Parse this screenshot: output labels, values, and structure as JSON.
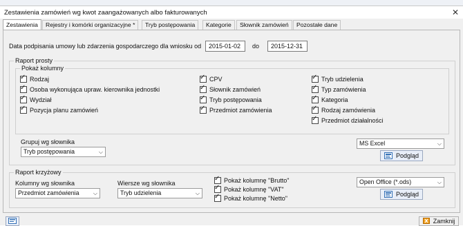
{
  "window": {
    "title": "Zestawienia zamówień wg kwot zaangażowanych albo fakturowanych",
    "close_glyph": "✕"
  },
  "tabs": [
    {
      "label": "Zestawienia"
    },
    {
      "label": "Rejestry i komórki organizacyjne *"
    },
    {
      "label": "Tryb postępowania"
    },
    {
      "label": "Kategorie"
    },
    {
      "label": "Słownik zamówień"
    },
    {
      "label": "Pozostałe dane"
    }
  ],
  "date_range": {
    "label": "Data podpisania umowy lub zdarzenia gospodarczego dla wniosku od",
    "from": "2015-01-02",
    "to_label": "do",
    "to": "2015-12-31"
  },
  "simple_report": {
    "title": "Raport prosty",
    "columns_title": "Pokaż kolumny",
    "col1": [
      "Rodzaj",
      "Osoba wykonująca upraw. kierownika jednostki",
      "Wydział",
      "Pozycja planu zamówień"
    ],
    "col2": [
      "CPV",
      "Słownik zamówień",
      "Tryb postępowania",
      "Przedmiot zamówienia"
    ],
    "col3": [
      "Tryb udzielenia",
      "Typ zamówienia",
      "Kategoria",
      "Rodzaj zamówienia",
      "Przedmiot działalności"
    ],
    "group_label": "Grupuj wg słownika",
    "group_value": "Tryb postępowania",
    "format_value": "MS Excel",
    "preview_label": "Podgląd"
  },
  "cross_report": {
    "title": "Raport krzyżowy",
    "columns_label": "Kolumny wg słownika",
    "columns_value": "Przedmiot zamówienia",
    "rows_label": "Wiersze wg słownika",
    "rows_value": "Tryb udzielenia",
    "options": [
      "Pokaż kolumnę \"Brutto\"",
      "Pokaż kolumnę \"VAT\"",
      "Pokaż kolumnę \"Netto\""
    ],
    "format_value": "Open Office (*.ods)",
    "preview_label": "Podgląd"
  },
  "footer": {
    "close_label": "Zamknij"
  },
  "icons": {
    "check": "✓",
    "dropdown": "⌵"
  },
  "colors": {
    "accent": "#2f6db5",
    "window_bg": "#f0f0f0",
    "button_bg": "#e8eef8"
  }
}
